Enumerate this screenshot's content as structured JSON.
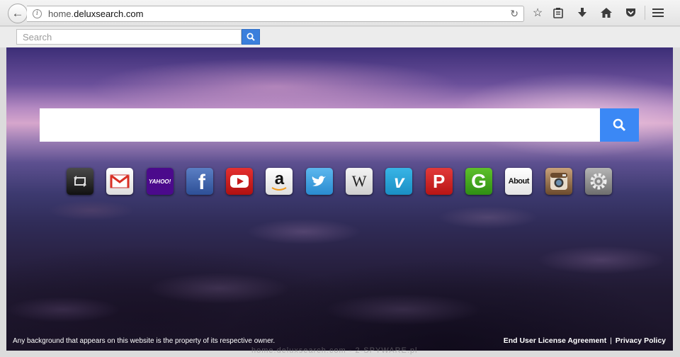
{
  "browser": {
    "url_prefix": "home.",
    "url_domain": "deluxsearch.com",
    "icons": [
      "back-arrow-icon",
      "info-icon",
      "reload-icon",
      "star-icon",
      "reading-list-icon",
      "download-icon",
      "home-icon",
      "pocket-icon",
      "hamburger-menu-icon"
    ]
  },
  "toolbar_search": {
    "placeholder": "Search",
    "button_color": "#3b7fdc"
  },
  "main": {
    "search_placeholder": "",
    "search_button_color": "#3b88f5",
    "shortcuts": [
      {
        "name": "shortcut-refresh",
        "label": "",
        "icon": "refresh-icon"
      },
      {
        "name": "shortcut-gmail",
        "label": "",
        "icon": "gmail-icon"
      },
      {
        "name": "shortcut-yahoo",
        "label": "YAHOO!",
        "icon": "yahoo-icon"
      },
      {
        "name": "shortcut-facebook",
        "label": "f",
        "icon": "facebook-icon"
      },
      {
        "name": "shortcut-youtube",
        "label": "",
        "icon": "youtube-icon"
      },
      {
        "name": "shortcut-amazon",
        "label": "a",
        "icon": "amazon-icon"
      },
      {
        "name": "shortcut-twitter",
        "label": "",
        "icon": "twitter-icon"
      },
      {
        "name": "shortcut-wikipedia",
        "label": "W",
        "icon": "wikipedia-icon"
      },
      {
        "name": "shortcut-vimeo",
        "label": "v",
        "icon": "vimeo-icon"
      },
      {
        "name": "shortcut-pinterest",
        "label": "P",
        "icon": "pinterest-icon"
      },
      {
        "name": "shortcut-g",
        "label": "G",
        "icon": "g-icon"
      },
      {
        "name": "shortcut-about",
        "label": "About",
        "icon": "about-icon"
      },
      {
        "name": "shortcut-instagram",
        "label": "",
        "icon": "instagram-icon"
      },
      {
        "name": "shortcut-settings",
        "label": "",
        "icon": "settings-gear-icon"
      }
    ]
  },
  "footer": {
    "disclaimer": "Any background that appears on this website is the property of its respective owner.",
    "eula": "End User License Agreement",
    "separator": "|",
    "privacy": "Privacy Policy"
  },
  "watermark": "home.deluxsearch.com - 2-SPYWARE.pl"
}
